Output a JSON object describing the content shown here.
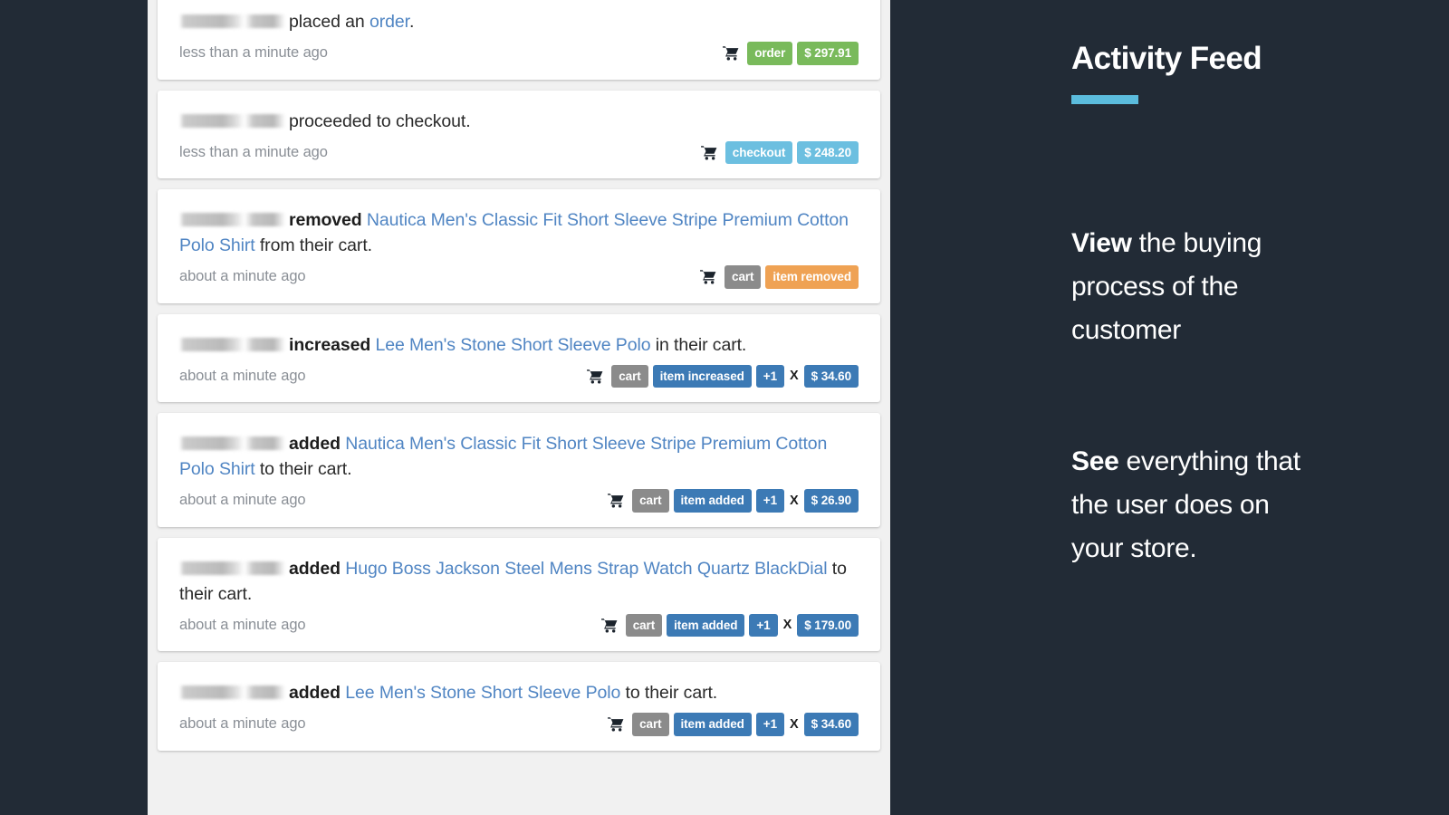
{
  "theme": {
    "background": "#222b36",
    "feed_background": "#f1f1f1",
    "card_background": "#ffffff",
    "link_color": "#5085c3",
    "accent_color": "#5bbcdd",
    "badge_green": "#79ba5b",
    "badge_light_blue": "#6cbfe0",
    "badge_gray": "#8b8b8b",
    "badge_orange": "#efa254",
    "badge_blue": "#3c7ab5"
  },
  "info_panel": {
    "title": "Activity Feed",
    "blocks": [
      {
        "lead": "View",
        "rest": " the buying process of the customer"
      },
      {
        "lead": "See",
        "rest": " everything that the user does on your store."
      }
    ]
  },
  "feed": {
    "cards": [
      {
        "actor": "[redacted name]",
        "verb": "",
        "pre_text": "placed an ",
        "link": "order",
        "post_text": ".",
        "timestamp": "less than a minute ago",
        "icon": "shopping-cart-icon",
        "badges": [
          {
            "label": "order",
            "style": "green"
          },
          {
            "label": "$ 297.91",
            "style": "green"
          }
        ],
        "multiplier": null
      },
      {
        "actor": "[redacted name]",
        "verb": "",
        "pre_text": "proceeded to checkout.",
        "link": "",
        "post_text": "",
        "timestamp": "less than a minute ago",
        "icon": "shopping-cart-icon",
        "badges": [
          {
            "label": "checkout",
            "style": "light-blue"
          },
          {
            "label": "$ 248.20",
            "style": "light-blue"
          }
        ],
        "multiplier": null
      },
      {
        "actor": "[redacted name]",
        "verb": "removed",
        "pre_text": " ",
        "link": "Nautica Men's Classic Fit Short Sleeve Stripe Premium Cotton Polo Shirt",
        "post_text": " from their cart.",
        "timestamp": "about a minute ago",
        "icon": "shopping-cart-icon",
        "badges": [
          {
            "label": "cart",
            "style": "gray"
          },
          {
            "label": "item removed",
            "style": "orange"
          }
        ],
        "multiplier": null
      },
      {
        "actor": "[redacted name]",
        "verb": "increased",
        "pre_text": " ",
        "link": "Lee Men's Stone Short Sleeve Polo",
        "post_text": " in their cart.",
        "timestamp": "about a minute ago",
        "icon": "shopping-cart-icon",
        "badges": [
          {
            "label": "cart",
            "style": "gray"
          },
          {
            "label": "item increased",
            "style": "blue"
          }
        ],
        "multiplier": {
          "qty": "+1",
          "times": "X",
          "amount": "$ 34.60"
        }
      },
      {
        "actor": "[redacted name]",
        "verb": "added",
        "pre_text": " ",
        "link": "Nautica Men's Classic Fit Short Sleeve Stripe Premium Cotton Polo Shirt",
        "post_text": " to their cart.",
        "timestamp": "about a minute ago",
        "icon": "shopping-cart-icon",
        "badges": [
          {
            "label": "cart",
            "style": "gray"
          },
          {
            "label": "item added",
            "style": "blue"
          }
        ],
        "multiplier": {
          "qty": "+1",
          "times": "X",
          "amount": "$ 26.90"
        }
      },
      {
        "actor": "[redacted name]",
        "verb": "added",
        "pre_text": " ",
        "link": "Hugo Boss Jackson Steel Mens Strap Watch Quartz BlackDial",
        "post_text": " to their cart.",
        "timestamp": "about a minute ago",
        "icon": "shopping-cart-icon",
        "badges": [
          {
            "label": "cart",
            "style": "gray"
          },
          {
            "label": "item added",
            "style": "blue"
          }
        ],
        "multiplier": {
          "qty": "+1",
          "times": "X",
          "amount": "$ 179.00"
        }
      },
      {
        "actor": "[redacted name]",
        "verb": "added",
        "pre_text": " ",
        "link": "Lee Men's Stone Short Sleeve Polo",
        "post_text": " to their cart.",
        "timestamp": "about a minute ago",
        "icon": "shopping-cart-icon",
        "badges": [
          {
            "label": "cart",
            "style": "gray"
          },
          {
            "label": "item added",
            "style": "blue"
          }
        ],
        "multiplier": {
          "qty": "+1",
          "times": "X",
          "amount": "$ 34.60"
        }
      }
    ]
  }
}
